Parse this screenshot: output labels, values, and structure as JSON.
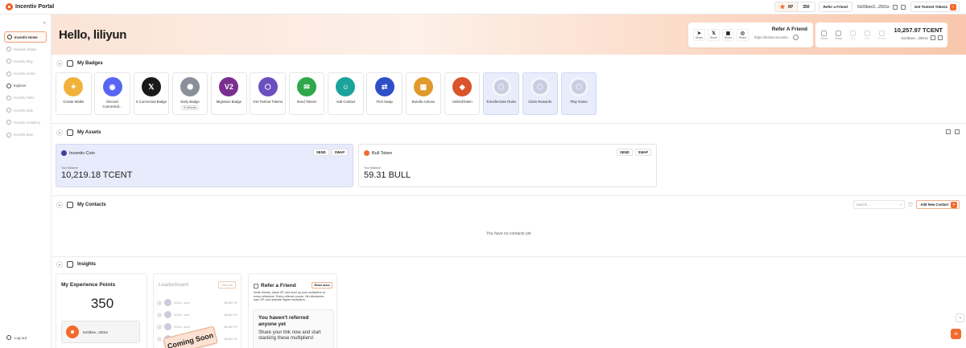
{
  "brand": {
    "name": "Incentiv Portal",
    "accent": "#f26b2c"
  },
  "topbar": {
    "xp_label": "XP",
    "xp_value": "350",
    "refer_label": "Refer a Friend",
    "address": "0x03bee3...2501e",
    "get_tokens_label": "Get Testnet Tokens"
  },
  "sidebar": {
    "items": [
      {
        "label": "Incentiv Home",
        "state": "active"
      },
      {
        "label": "Network Status",
        "state": "disabled"
      },
      {
        "label": "Incentiv Play",
        "state": "disabled"
      },
      {
        "label": "Incentiv Arena",
        "state": "disabled"
      },
      {
        "label": "Explorer",
        "state": "enabled"
      },
      {
        "label": "Incentiv Yield",
        "state": "disabled"
      },
      {
        "label": "Incentiv Safe",
        "state": "disabled"
      },
      {
        "label": "Incentiv Academy",
        "state": "disabled"
      },
      {
        "label": "Incentiv Earn",
        "state": "disabled"
      }
    ],
    "logout_label": "Log out"
  },
  "hero": {
    "greeting": "Hello, liliyun",
    "share": {
      "buttons": [
        {
          "label": "Share",
          "glyph": "➤"
        },
        {
          "label": "Share",
          "glyph": "𝕏"
        },
        {
          "label": "Share",
          "glyph": "▣"
        },
        {
          "label": "Share",
          "glyph": "◎"
        }
      ],
      "title": "Refer A Friend",
      "link": "https://testnet.incentiv..."
    },
    "token": {
      "actions": [
        {
          "label": "Send",
          "enabled": true
        },
        {
          "label": "Swap",
          "enabled": true
        },
        {
          "label": "Buy",
          "enabled": false
        },
        {
          "label": "Earn",
          "enabled": false
        },
        {
          "label": "Bridge",
          "enabled": false
        }
      ],
      "amount": "10,257.97 TCENT",
      "address": "0x03bee...2501e"
    }
  },
  "badges": {
    "title": "My Badges",
    "items": [
      {
        "name": "Create Wallet",
        "color": "#f1b23a",
        "glyph": "✦",
        "locked": false
      },
      {
        "name": "Discord Connected...",
        "color": "#5865f2",
        "glyph": "◉",
        "locked": false
      },
      {
        "name": "X Connected Badge",
        "color": "#1a1a1a",
        "glyph": "𝕏",
        "locked": false
      },
      {
        "name": "Early Badge",
        "color": "#8a8f99",
        "glyph": "⬢",
        "locked": false,
        "pill": "5 referrals"
      },
      {
        "name": "Migration Badge",
        "color": "#7a2f8f",
        "glyph": "V2",
        "locked": false
      },
      {
        "name": "Get Testnet Tokens",
        "color": "#6b4fbf",
        "glyph": "⬡",
        "locked": false
      },
      {
        "name": "Send Tokens",
        "color": "#2ea84a",
        "glyph": "✉",
        "locked": false
      },
      {
        "name": "Add Contact",
        "color": "#1aa39a",
        "glyph": "☺",
        "locked": false
      },
      {
        "name": "First Swap",
        "color": "#2f4fc9",
        "glyph": "⇄",
        "locked": false
      },
      {
        "name": "Bundle Actions",
        "color": "#e09a2b",
        "glyph": "▦",
        "locked": false
      },
      {
        "name": "UnifiedToken",
        "color": "#d9542a",
        "glyph": "◆",
        "locked": false
      },
      {
        "name": "TransferGate Rules",
        "color": "#c9cde0",
        "glyph": "⬡",
        "locked": true
      },
      {
        "name": "Claim Rewards",
        "color": "#c9cde0",
        "glyph": "⬡",
        "locked": true
      },
      {
        "name": "Play Game",
        "color": "#c9cde0",
        "glyph": "⬡",
        "locked": true
      }
    ]
  },
  "assets": {
    "title": "My Assets",
    "items": [
      {
        "name": "Incentiv Coin",
        "coin_color": "#3b3f9e",
        "balance_label": "Your Balance",
        "balance": "10,219.18 TCENT",
        "send": "SEND",
        "swap": "SWAP"
      },
      {
        "name": "Bull Token",
        "coin_color": "#f26b2c",
        "balance_label": "Your Balance",
        "balance": "59.31 BULL",
        "send": "SEND",
        "swap": "SWAP"
      }
    ]
  },
  "contacts": {
    "title": "My Contacts",
    "search_placeholder": "Search...",
    "add_label": "Add New Contact",
    "empty_message": "You have no contacts yet"
  },
  "insights": {
    "title": "Insights",
    "xp": {
      "title": "My Experience Points",
      "value": "350",
      "user": "0x03bee...2501e"
    },
    "leaderboard": {
      "title": "Leaderboard",
      "view_all": "View All",
      "rows": [
        {
          "addr": "0x0c4...ac1c",
          "pts": "48,680 XP"
        },
        {
          "addr": "0x0c4...ac1c",
          "pts": "48,680 XP"
        },
        {
          "addr": "0x0c4...ac1c",
          "pts": "48,680 XP"
        },
        {
          "addr": "0x0c4...ac1c",
          "pts": "48,680 XP"
        }
      ],
      "coming_soon": "Coming Soon"
    },
    "refer": {
      "title": "Refer a Friend",
      "read_more": "Read more",
      "desc": "Invite friends, stack XP, and level up your multipliers at every milestone. Every referral counts. Hit milestones, earn XP, and activate higher multipliers.",
      "empty_title": "You haven't referred anyone yet",
      "empty_desc": "Share your link now and start stacking these multipliers!"
    }
  }
}
